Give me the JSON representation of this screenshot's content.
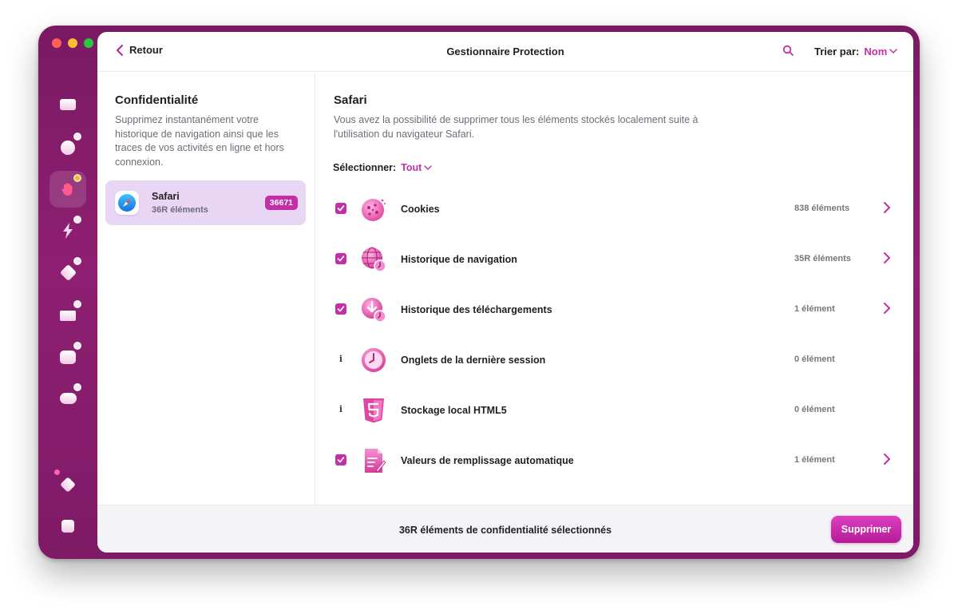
{
  "header": {
    "back_label": "Retour",
    "title": "Gestionnaire Protection",
    "sort_label": "Trier par:",
    "sort_value": "Nom"
  },
  "sidebar": {
    "title": "Confidentialité",
    "description": "Supprimez instantanément votre historique de navigation ainsi que les traces de vos activités en ligne et hors connexion.",
    "apps": [
      {
        "name": "Safari",
        "count_label": "36R éléments",
        "badge": "36671"
      }
    ]
  },
  "detail": {
    "title": "Safari",
    "description": "Vous avez la possibilité de supprimer tous les éléments stockés localement suite à l'utilisation du navigateur Safari.",
    "select_label": "Sélectionner:",
    "select_value": "Tout",
    "items": [
      {
        "name": "Cookies",
        "count": "838 éléments",
        "checked": true,
        "icon": "cookie-icon"
      },
      {
        "name": "Historique de navigation",
        "count": "35R éléments",
        "checked": true,
        "icon": "globe-icon"
      },
      {
        "name": "Historique des téléchargements",
        "count": "1 élément",
        "checked": true,
        "icon": "download-history-icon"
      },
      {
        "name": "Onglets de la dernière session",
        "count": "0 élément",
        "checked": false,
        "icon": "clock-icon"
      },
      {
        "name": "Stockage local HTML5",
        "count": "0 élément",
        "checked": false,
        "icon": "html5-icon"
      },
      {
        "name": "Valeurs de remplissage automatique",
        "count": "1 élément",
        "checked": true,
        "icon": "autofill-icon"
      }
    ]
  },
  "footer": {
    "summary": "36R éléments de confidentialité sélectionnés",
    "delete_label": "Supprimer"
  },
  "colors": {
    "accent": "#c22fa8",
    "window_frame": "#8e1f72",
    "selected_card": "#e9d6f5"
  }
}
